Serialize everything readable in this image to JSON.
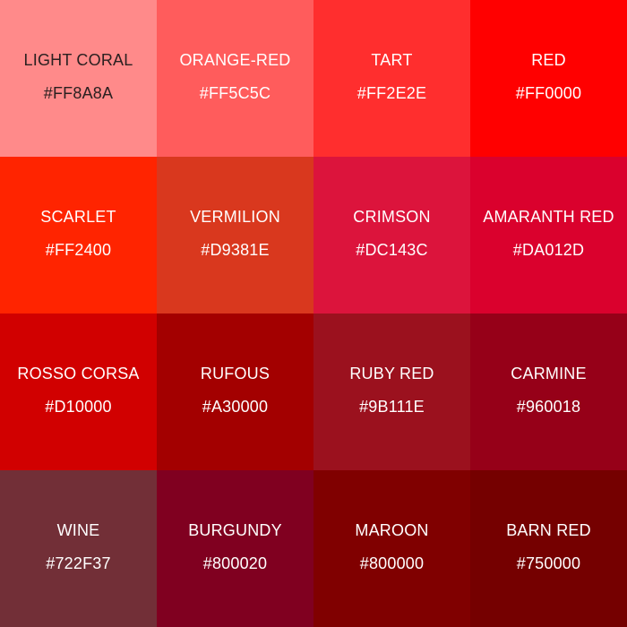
{
  "colors": [
    {
      "name": "LIGHT CORAL",
      "hex": "#FF8A8A",
      "swatch": "#FF8A8A",
      "text_color": "dark"
    },
    {
      "name": "ORANGE-RED",
      "hex": "#FF5C5C",
      "swatch": "#FF5C5C",
      "text_color": "light"
    },
    {
      "name": "TART",
      "hex": "#FF2E2E",
      "swatch": "#FF2E2E",
      "text_color": "light"
    },
    {
      "name": "RED",
      "hex": "#FF0000",
      "swatch": "#FF0000",
      "text_color": "light"
    },
    {
      "name": "SCARLET",
      "hex": "#FF2400",
      "swatch": "#FF2400",
      "text_color": "light"
    },
    {
      "name": "VERMILION",
      "hex": "#D9381E",
      "swatch": "#D9381E",
      "text_color": "light"
    },
    {
      "name": "CRIMSON",
      "hex": "#DC143C",
      "swatch": "#DC143C",
      "text_color": "light"
    },
    {
      "name": "AMARANTH RED",
      "hex": "#DA012D",
      "swatch": "#DA012D",
      "text_color": "light"
    },
    {
      "name": "ROSSO CORSA",
      "hex": "#D10000",
      "swatch": "#D10000",
      "text_color": "light"
    },
    {
      "name": "RUFOUS",
      "hex": "#A30000",
      "swatch": "#A30000",
      "text_color": "light"
    },
    {
      "name": "RUBY RED",
      "hex": "#9B111E",
      "swatch": "#9B111E",
      "text_color": "light"
    },
    {
      "name": "CARMINE",
      "hex": "#960018",
      "swatch": "#960018",
      "text_color": "light"
    },
    {
      "name": "WINE",
      "hex": "#722F37",
      "swatch": "#722F37",
      "text_color": "light"
    },
    {
      "name": "BURGUNDY",
      "hex": "#800020",
      "swatch": "#800020",
      "text_color": "light"
    },
    {
      "name": "MAROON",
      "hex": "#800000",
      "swatch": "#800000",
      "text_color": "light"
    },
    {
      "name": "BARN RED",
      "hex": "#750000",
      "swatch": "#750000",
      "text_color": "light"
    }
  ]
}
